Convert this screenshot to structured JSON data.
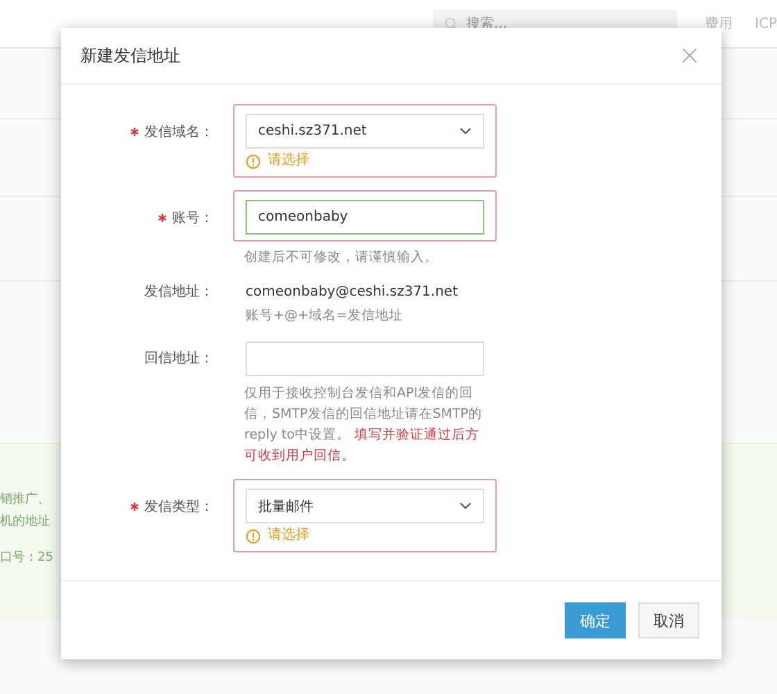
{
  "background": {
    "search": {
      "placeholder": "搜索..."
    },
    "nav": [
      "费用",
      "ICP"
    ],
    "notice_lines": [
      "销推广、",
      "机的地址",
      "口号：25"
    ]
  },
  "dialog": {
    "title": "新建发信地址",
    "fields": [
      {
        "kind": "select",
        "label": "发信域名：",
        "required": true,
        "invalid": true,
        "value": "ceshi.sz371.net",
        "error": "请选择"
      },
      {
        "kind": "input",
        "label": "账号：",
        "required": true,
        "invalid": true,
        "focused": true,
        "value": "comeonbaby",
        "hint": "创建后不可修改，请谨慎输入。"
      },
      {
        "kind": "text",
        "label": "发信地址：",
        "required": false,
        "invalid": false,
        "value": "comeonbaby@ceshi.sz371.net",
        "hint": "账号+@+域名=发信地址"
      },
      {
        "kind": "input",
        "label": "回信地址：",
        "required": false,
        "invalid": false,
        "focused": false,
        "hint": "仅用于接收控制台发信和API发信的回信，SMTP发信的回信地址请在SMTP的reply to中设置。",
        "hint_alert": "填写并验证通过后方可收到用户回信。"
      },
      {
        "kind": "select",
        "label": "发信类型：",
        "required": true,
        "invalid": true,
        "value": "批量邮件",
        "error": "请选择"
      }
    ],
    "buttons": [
      {
        "label": "确定",
        "kind": "primary"
      },
      {
        "label": "取消",
        "kind": "default"
      }
    ]
  }
}
